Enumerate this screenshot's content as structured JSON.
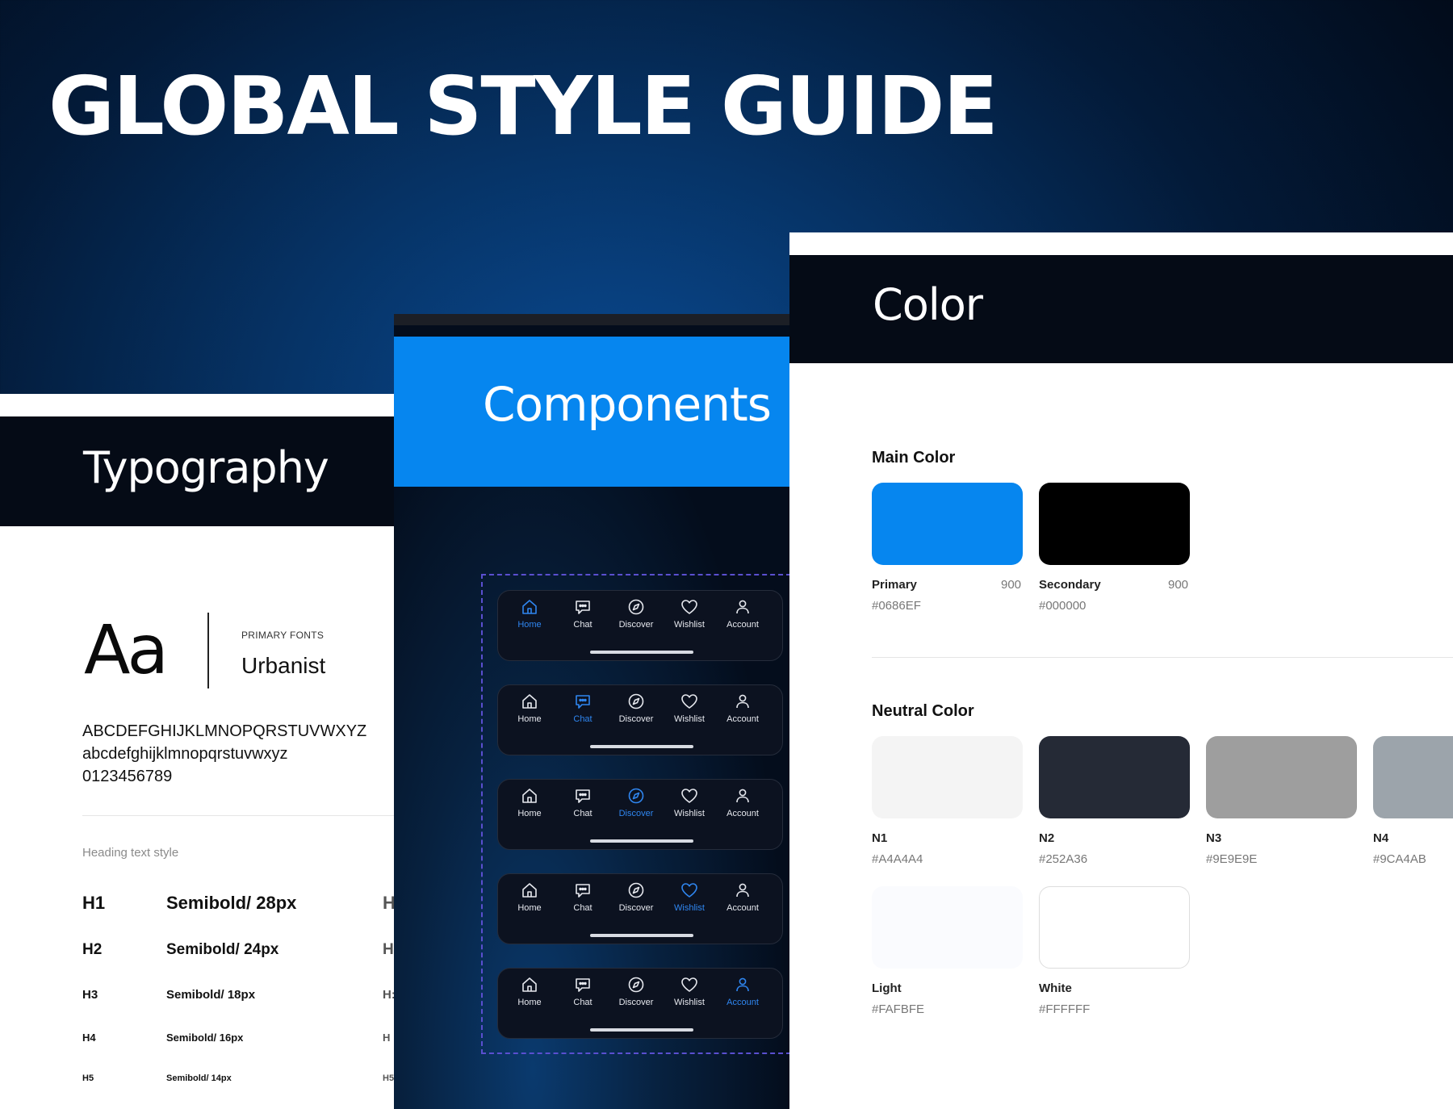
{
  "title": "GLOBAL STYLE GUIDE",
  "typography": {
    "header": "Typography",
    "sample": "Aa",
    "primary_fonts_label": "PRIMARY FONTS",
    "font_name": "Urbanist",
    "uppercase": "ABCDEFGHIJKLMNOPQRSTUVWXYZ",
    "lowercase": "abcdefghijklmnopqrstuvwxyz",
    "digits": "0123456789",
    "heading_label": "Heading text style",
    "rows": [
      {
        "tag": "H1",
        "spec": "Semibold/ 28px",
        "tag2": "H"
      },
      {
        "tag": "H2",
        "spec": "Semibold/ 24px",
        "tag2": "H"
      },
      {
        "tag": "H3",
        "spec": "Semibold/ 18px",
        "tag2": "H:"
      },
      {
        "tag": "H4",
        "spec": "Semibold/ 16px",
        "tag2": "H"
      },
      {
        "tag": "H5",
        "spec": "Semibold/ 14px",
        "tag2": "H5"
      }
    ]
  },
  "components": {
    "header": "Components",
    "nav_labels": [
      "Home",
      "Chat",
      "Discover",
      "Wishlist",
      "Account"
    ],
    "nav_icons": [
      "home-icon",
      "chat-icon",
      "compass-icon",
      "heart-icon",
      "user-icon"
    ],
    "active_color": "#2F86F0"
  },
  "color": {
    "header": "Color",
    "main_title": "Main Color",
    "neutral_title": "Neutral Color",
    "main": [
      {
        "name": "Primary",
        "shade": "900",
        "hex": "#0686EF",
        "color": "#0686EF"
      },
      {
        "name": "Secondary",
        "shade": "900",
        "hex": "#000000",
        "color": "#000000"
      }
    ],
    "neutral": [
      {
        "name": "N1",
        "hex": "#A4A4A4",
        "color": "#F4F4F4"
      },
      {
        "name": "N2",
        "hex": "#252A36",
        "color": "#252A36"
      },
      {
        "name": "N3",
        "hex": "#9E9E9E",
        "color": "#9E9E9E"
      },
      {
        "name": "N4",
        "hex": "#9CA4AB",
        "color": "#9CA4AB"
      },
      {
        "name": "Light",
        "hex": "#FAFBFE",
        "color": "#FAFBFE"
      },
      {
        "name": "White",
        "hex": "#FFFFFF",
        "color": "#FFFFFF"
      }
    ]
  }
}
